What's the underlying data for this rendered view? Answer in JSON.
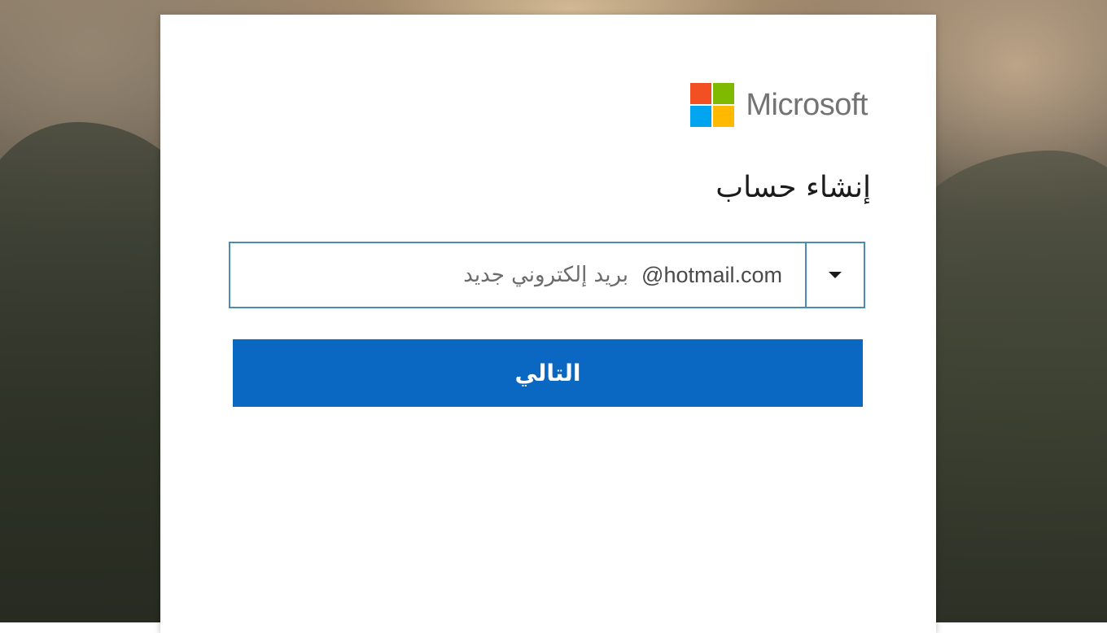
{
  "brand": {
    "name": "Microsoft",
    "colors": {
      "red": "#f25022",
      "green": "#7fba00",
      "blue": "#00a4ef",
      "yellow": "#ffb900",
      "text": "#737373"
    }
  },
  "form": {
    "title": "إنشاء حساب",
    "email_placeholder": "بريد إلكتروني جديد",
    "email_value": "",
    "domain_value": "@hotmail.com",
    "dropdown_icon": "chevron-down-icon",
    "next_label": "التالي",
    "accent_color": "#0a67c2"
  }
}
